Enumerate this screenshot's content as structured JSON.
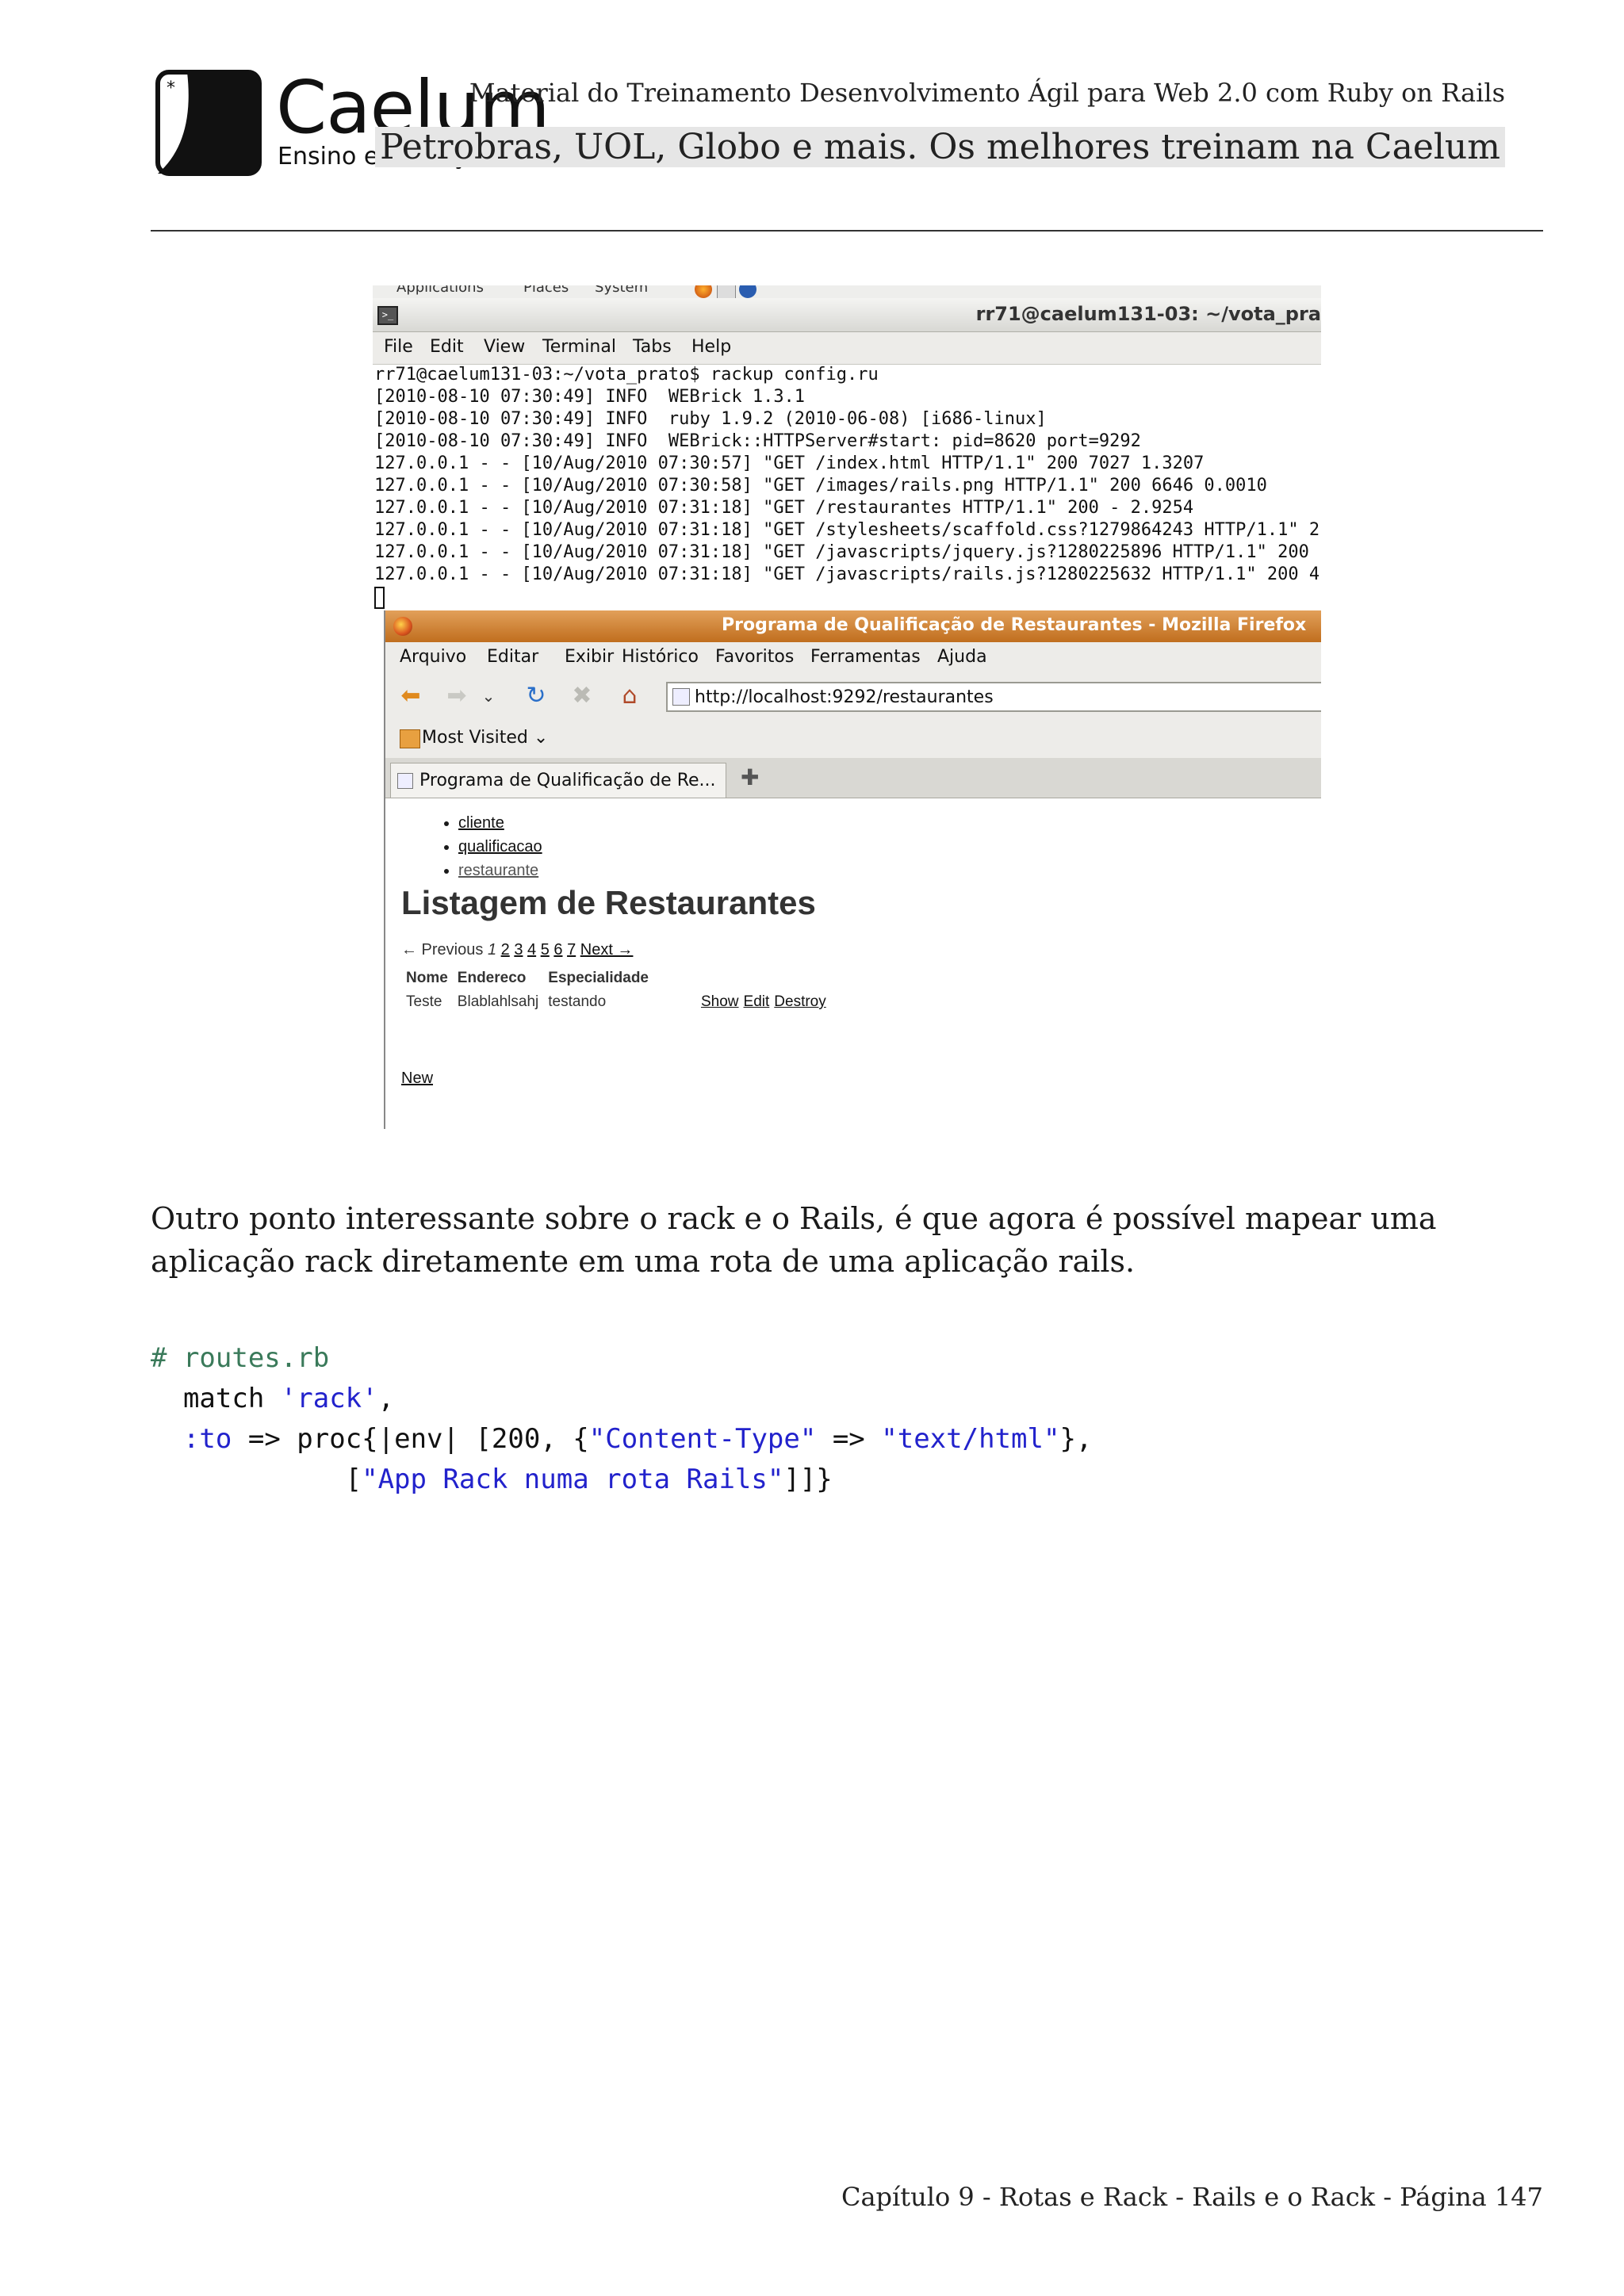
{
  "header": {
    "logo_name": "Caelum",
    "logo_tagline": "Ensino e Inovação",
    "line1": "Material do Treinamento Desenvolvimento Ágil para Web 2.0 com Ruby on Rails",
    "line2": "Petrobras, UOL, Globo e mais. Os melhores treinam na Caelum"
  },
  "screenshot": {
    "gnome_panel": [
      "Applications",
      "Places",
      "System"
    ],
    "terminal": {
      "title": "rr71@caelum131-03: ~/vota_pra",
      "menu": [
        "File",
        "Edit",
        "View",
        "Terminal",
        "Tabs",
        "Help"
      ],
      "lines": [
        "rr71@caelum131-03:~/vota_prato$ rackup config.ru",
        "[2010-08-10 07:30:49] INFO  WEBrick 1.3.1",
        "[2010-08-10 07:30:49] INFO  ruby 1.9.2 (2010-06-08) [i686-linux]",
        "[2010-08-10 07:30:49] INFO  WEBrick::HTTPServer#start: pid=8620 port=9292",
        "127.0.0.1 - - [10/Aug/2010 07:30:57] \"GET /index.html HTTP/1.1\" 200 7027 1.3207",
        "127.0.0.1 - - [10/Aug/2010 07:30:58] \"GET /images/rails.png HTTP/1.1\" 200 6646 0.0010",
        "127.0.0.1 - - [10/Aug/2010 07:31:18] \"GET /restaurantes HTTP/1.1\" 200 - 2.9254",
        "127.0.0.1 - - [10/Aug/2010 07:31:18] \"GET /stylesheets/scaffold.css?1279864243 HTTP/1.1\" 2",
        "127.0.0.1 - - [10/Aug/2010 07:31:18] \"GET /javascripts/jquery.js?1280225896 HTTP/1.1\" 200",
        "127.0.0.1 - - [10/Aug/2010 07:31:18] \"GET /javascripts/rails.js?1280225632 HTTP/1.1\" 200 4"
      ]
    },
    "firefox": {
      "title": "Programa de Qualificação de Restaurantes - Mozilla Firefox",
      "menu": [
        "Arquivo",
        "Editar",
        "Exibir",
        "Histórico",
        "Favoritos",
        "Ferramentas",
        "Ajuda"
      ],
      "url": "http://localhost:9292/restaurantes",
      "bookmark": "Most Visited",
      "tab_title": "Programa de Qualificação de Re...",
      "page": {
        "links": [
          "cliente",
          "qualificacao",
          "restaurante"
        ],
        "heading": "Listagem de Restaurantes",
        "pager_prev": "← Previous",
        "pager_current": "1",
        "pager_pages": [
          "2",
          "3",
          "4",
          "5",
          "6",
          "7"
        ],
        "pager_next": "Next →",
        "columns": [
          "Nome",
          "Endereco",
          "Especialidade"
        ],
        "row": {
          "nome": "Teste",
          "endereco": "Blablahlsahj",
          "especialidade": "testando"
        },
        "actions": [
          "Show",
          "Edit",
          "Destroy"
        ],
        "new_link": "New"
      }
    }
  },
  "body": {
    "paragraph": "Outro ponto interessante sobre o rack e o Rails, é que agora é possível mapear uma aplicação rack diretamente em uma rota de uma aplicação rails.",
    "code": {
      "comment": "# routes.rb",
      "match_kw": "match",
      "match_str": "'rack'",
      "to_sym": ":to",
      "arrow": "=>",
      "proc": "proc{|env| [200, {",
      "ct_key": "\"Content-Type\"",
      "ct_val": "\"text/html\"",
      "body_str": "\"App Rack numa rota Rails\""
    }
  },
  "footer": "Capítulo 9 - Rotas e Rack -  Rails e o Rack - Página 147"
}
